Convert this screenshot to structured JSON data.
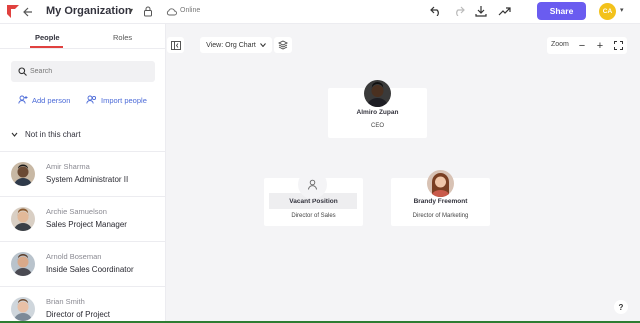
{
  "header": {
    "title": "My Organization",
    "status": "Online",
    "share_label": "Share",
    "user_initials": "CA"
  },
  "sidebar": {
    "tabs": [
      {
        "label": "People",
        "active": true
      },
      {
        "label": "Roles",
        "active": false
      }
    ],
    "search_placeholder": "Search",
    "add_person_label": "Add person",
    "import_people_label": "Import people",
    "section_label": "Not in this chart",
    "people": [
      {
        "name": "Amir Sharma",
        "role": "System Administrator II"
      },
      {
        "name": "Archie Samuelson",
        "role": "Sales Project Manager"
      },
      {
        "name": "Arnold Boseman",
        "role": "Inside Sales Coordinator"
      },
      {
        "name": "Brian Smith",
        "role": "Director of Project Implementation"
      }
    ]
  },
  "canvas": {
    "view_label": "View: Org Chart",
    "zoom_label": "Zoom",
    "help_label": "?",
    "nodes": [
      {
        "name": "Almiro Zupan",
        "role": "CEO"
      },
      {
        "name": "Vacant Position",
        "role": "Director of Sales"
      },
      {
        "name": "Brandy Freemont",
        "role": "Director of Marketing"
      }
    ]
  },
  "colors": {
    "accent": "#6a5cf0",
    "tab_underline": "#e0413f",
    "link": "#4c6bd8",
    "avatar": "#f3c21b",
    "canvas_bg": "#f4f4f6"
  }
}
